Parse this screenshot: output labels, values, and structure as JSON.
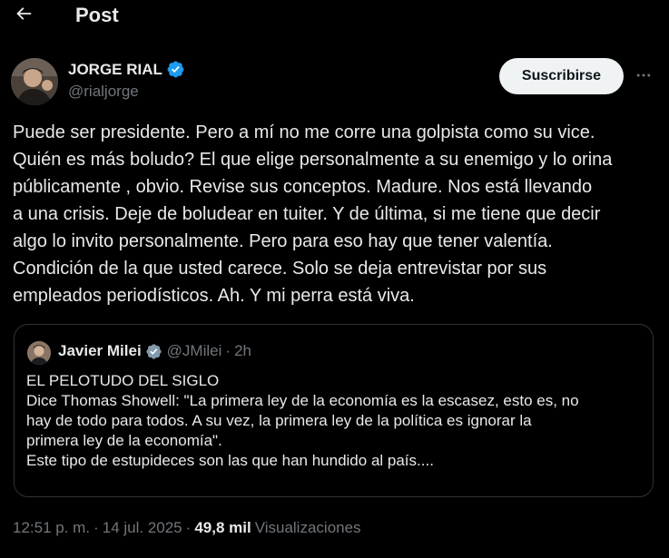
{
  "header": {
    "back_icon": "arrow-left-icon",
    "title": "Post"
  },
  "author": {
    "name": "JORGE RIAL",
    "handle": "@rialjorge",
    "verified_icon": "verified-badge-icon",
    "verified_color": "#1d9bf0"
  },
  "actions": {
    "subscribe_label": "Suscribirse",
    "more_icon": "more-horizontal-icon"
  },
  "post": {
    "lines": [
      "Puede ser presidente. Pero a mí no me corre una golpista como su vice.",
      "Quién es más boludo? El que elige personalmente a su enemigo y lo orina",
      "públicamente , obvio. Revise sus conceptos. Madure. Nos está llevando",
      "a una crisis. Deje de boludear en tuiter. Y de última, si me tiene que decir",
      "algo lo invito personalmente. Pero para eso hay que tener valentía.",
      "Condición de la que usted carece. Solo se deja entrevistar por sus",
      "empleados periodísticos. Ah. Y mi perra está viva."
    ]
  },
  "quote": {
    "name": "Javier Milei",
    "handle": "@JMilei",
    "separator": "·",
    "time": "2h",
    "lines": [
      "EL PELOTUDO DEL SIGLO",
      "Dice Thomas Showell: \"La primera ley de la economía es la escasez, esto es, no",
      "hay de todo para todos. A su vez, la primera ley de la política es ignorar la",
      "primera ley de la economía\".",
      "Este tipo de estupideces son las que han hundido al país...."
    ]
  },
  "meta": {
    "time": "12:51 p. m.",
    "separator": "·",
    "date": "14 jul. 2025",
    "views_count": "49,8 mil",
    "views_label": "Visualizaciones"
  }
}
